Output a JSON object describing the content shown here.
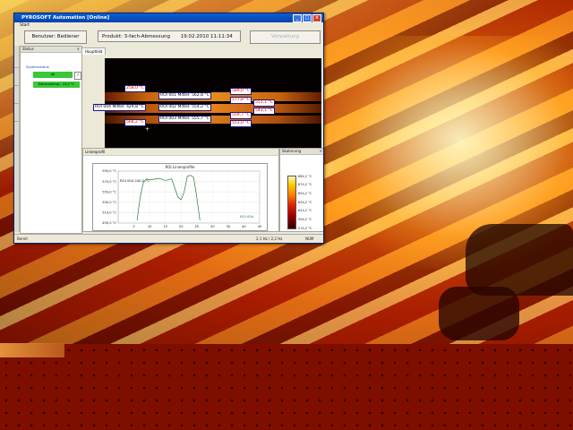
{
  "window": {
    "title": "PYROSOFT Automation [Online]",
    "menu": [
      "Start"
    ]
  },
  "toolbar": {
    "user_label": "Benutzer: Bediener",
    "product_label": "Produkt: 3-fach-Abmessung",
    "datetime": "19.02.2010 11:11:34",
    "disabled_button": "Verwaltung"
  },
  "status_panel": {
    "title": "Status",
    "system_label": "Systemstatus",
    "row1_value": "ok",
    "row1_box": "?",
    "row2_value": "Kamerastrmg... 24,2 °C"
  },
  "image_tab": "Hauptbild",
  "thermal_labels": {
    "t1": "258,0 °C",
    "t2": "ROI 001 Mittel: 562,8 °C",
    "t3": "ROI 004 Mittel: 429,8 °C",
    "t4": "ROI 002 Mittel: 554,2 °C",
    "t5": "ROI 003 Mittel: 555,7 °C",
    "t6": "568,2 °C",
    "t7": "589,0 °C",
    "t8": "577,8 °C",
    "t9": "551,1 °C",
    "t10": "559,7 °C",
    "t11": "543,1 °C",
    "t12": "553,0 °C"
  },
  "chart_panel": {
    "title": "ROI Linienprofile",
    "annotation": "ROI 004 240,2 °C",
    "legend": "ROI 004",
    "tab": "Linienprofil"
  },
  "chart_data": {
    "type": "line",
    "title": "ROI Linienprofile",
    "xlabel": "",
    "ylabel": "",
    "ylim": [
      490,
      590
    ],
    "xlim": [
      0,
      45
    ],
    "yticks": [
      "590,0 °C",
      "570,0 °C",
      "550,0 °C",
      "530,0 °C",
      "510,0 °C",
      "490,0 °C"
    ],
    "xticks": [
      "5",
      "10",
      "15",
      "20",
      "25",
      "30",
      "35",
      "40",
      "45"
    ],
    "series": [
      {
        "name": "ROI 004",
        "x": [
          6,
          7,
          8,
          9,
          10,
          11,
          13,
          15,
          17,
          19,
          20,
          21,
          22,
          23,
          24,
          25,
          26
        ],
        "y": [
          495,
          540,
          568,
          575,
          573,
          574,
          576,
          572,
          575,
          540,
          535,
          550,
          580,
          582,
          578,
          540,
          495
        ]
      }
    ]
  },
  "scale_panel": {
    "title": "Skalierung",
    "ticks": [
      "684,2 °C",
      "674,2 °C",
      "654,2 °C",
      "634,2 °C",
      "614,2 °C",
      "594,2 °C",
      "574,2 °C"
    ]
  },
  "statusbar": {
    "left": "Bereit",
    "mid": "2,1 Hz / 2,2 Hz",
    "right": "NUM"
  },
  "colors": {
    "title_bar": "#0842a8",
    "ok_green": "#38c838",
    "desktop_red": "#7d0e00"
  }
}
